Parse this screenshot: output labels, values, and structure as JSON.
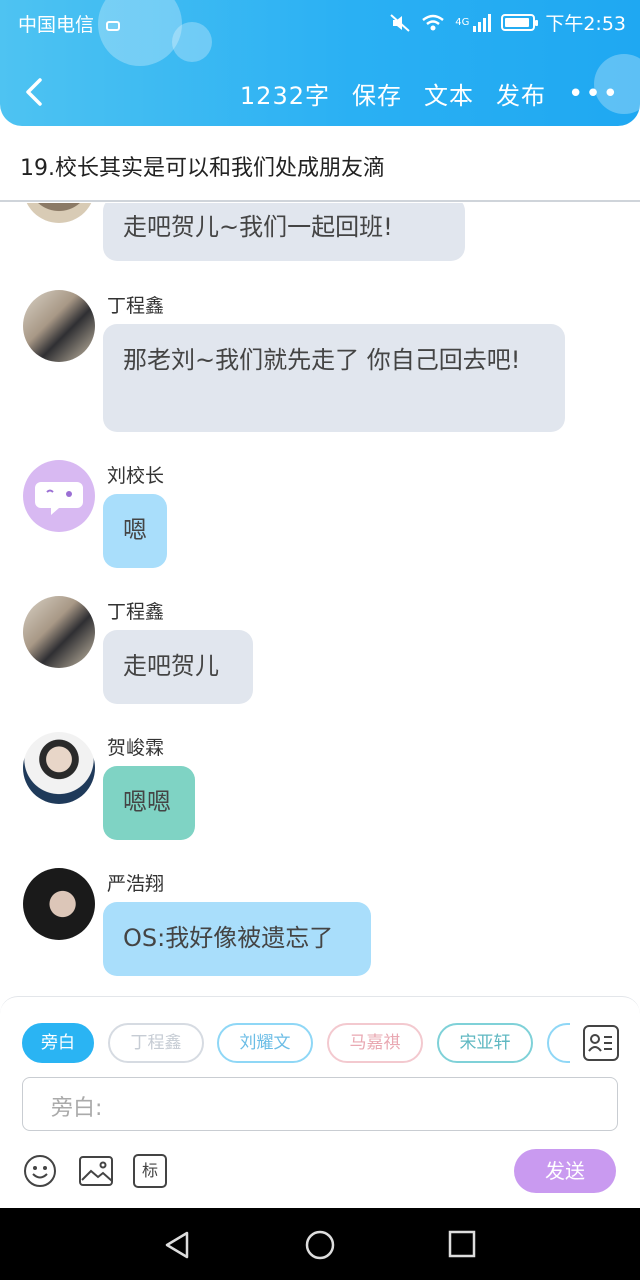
{
  "status_bar": {
    "carrier": "中国电信",
    "time": "下午2:53",
    "network": "4G"
  },
  "toolbar": {
    "word_count": "1232字",
    "save": "保存",
    "text": "文本",
    "publish": "发布",
    "more": "•••"
  },
  "story_title": "19.校长其实是可以和我们处成朋友滴",
  "messages": [
    {
      "speaker": "",
      "text": "走吧贺儿~我们一起回班!"
    },
    {
      "speaker": "丁程鑫",
      "text": "那老刘~我们就先走了 你自己回去吧!"
    },
    {
      "speaker": "刘校长",
      "text": "嗯"
    },
    {
      "speaker": "丁程鑫",
      "text": "走吧贺儿"
    },
    {
      "speaker": "贺峻霖",
      "text": "嗯嗯"
    },
    {
      "speaker": "严浩翔",
      "text": "OS:我好像被遗忘了"
    }
  ],
  "roles": [
    {
      "label": "旁白",
      "color": "#2ab4f3"
    },
    {
      "label": "丁程鑫",
      "color": "#d6dbe2"
    },
    {
      "label": "刘耀文",
      "color": "#8fd7f6"
    },
    {
      "label": "马嘉祺",
      "color": "#f3c9cf"
    },
    {
      "label": "宋亚轩",
      "color": "#7fd1d8"
    },
    {
      "label": "",
      "color": "#8fd7f6"
    }
  ],
  "input": {
    "placeholder": "旁白:"
  },
  "tools": {
    "tag_label": "标"
  },
  "send_label": "发送"
}
